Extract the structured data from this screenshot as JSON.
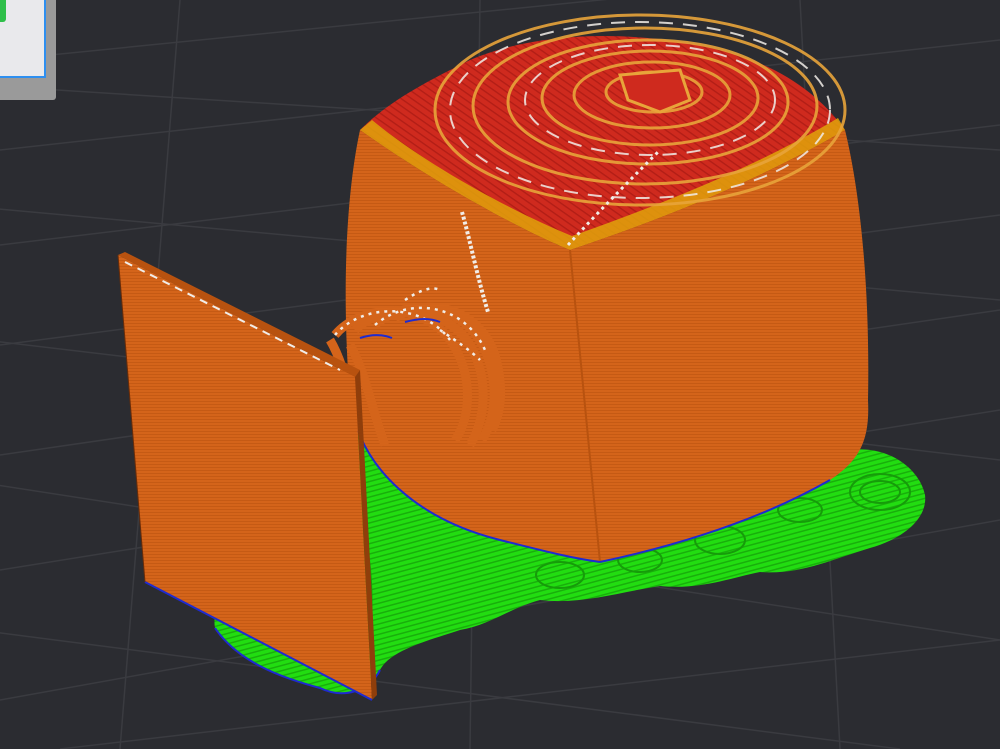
{
  "app": {
    "view": "3D preview"
  },
  "viewport": {
    "background": "#2b2c31",
    "grid_color": "#3a3b40",
    "colors": {
      "wall": "#d4641a",
      "wall_dark": "#b8520f",
      "top_solid": "#cf2a1e",
      "top_edge": "#e0a30a",
      "support": "#22dd11",
      "support_dark": "#169c0a",
      "travel_white": "#e8e2dc",
      "first_layer_edge": "#1f2bd0"
    },
    "objects": [
      {
        "name": "rounded-cube-model"
      },
      {
        "name": "flat-panel-model"
      },
      {
        "name": "bridge-loops"
      },
      {
        "name": "support-structures"
      }
    ]
  },
  "corner_widget": {
    "icon": "view-cube-icon"
  }
}
